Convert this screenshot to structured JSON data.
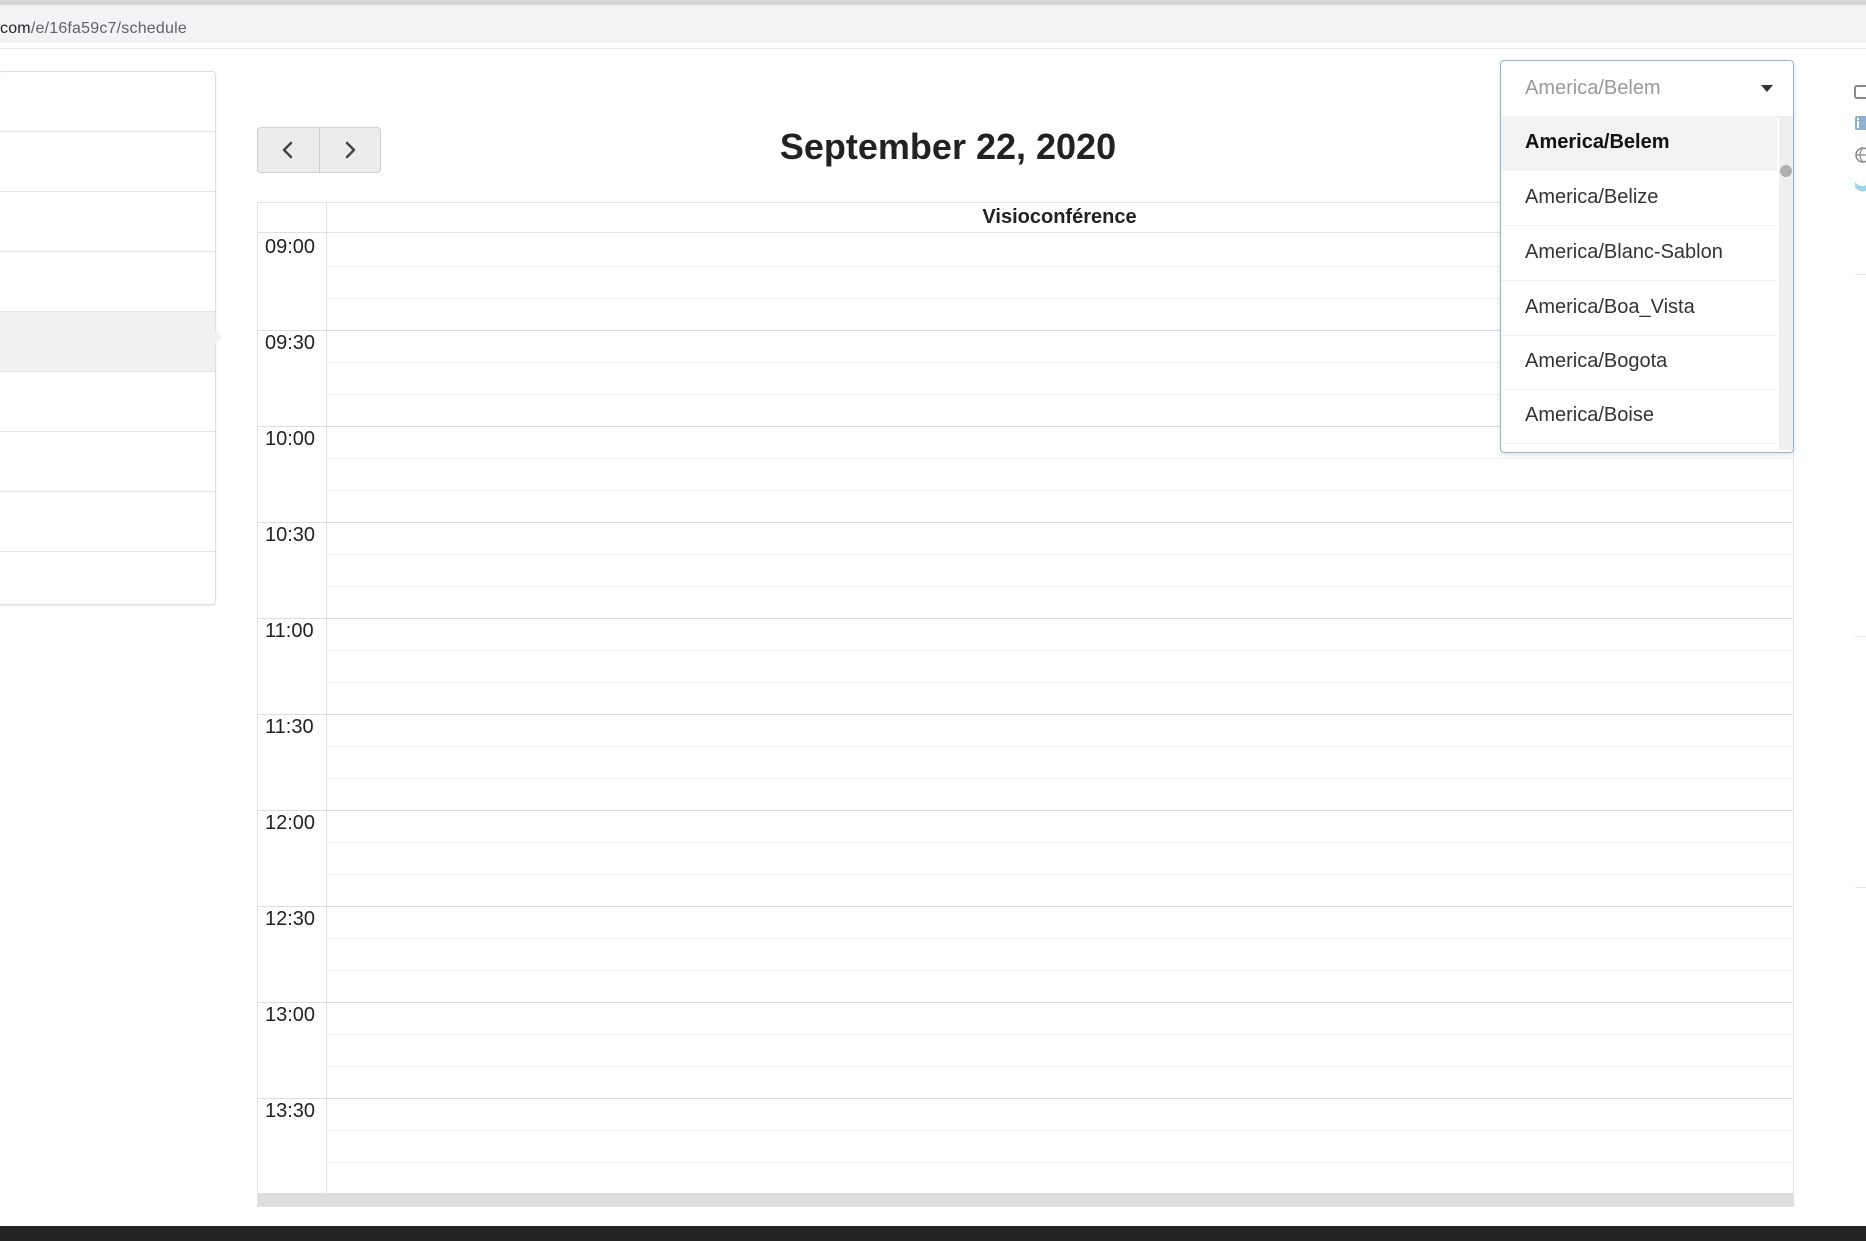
{
  "browser": {
    "url_host": "com",
    "url_path": "/e/16fa59c7/schedule"
  },
  "calendar": {
    "date_title": "September 22, 2020",
    "column_title": "Visioconférence",
    "prev_icon": "chevron-left-icon",
    "next_icon": "chevron-right-icon",
    "time_labels": [
      "09:00",
      "09:30",
      "10:00",
      "10:30",
      "11:00",
      "11:30",
      "12:00",
      "12:30",
      "13:00",
      "13:30"
    ]
  },
  "timezone": {
    "selected": "America/Belem",
    "options": [
      "America/Belem",
      "America/Belize",
      "America/Blanc-Sablon",
      "America/Boa_Vista",
      "America/Bogota",
      "America/Boise"
    ]
  },
  "side_icons": [
    "camera-icon",
    "linkedin-icon",
    "globe-icon",
    "twitter-icon"
  ],
  "colors": {
    "linkedin": "#8fb0d0",
    "twitter": "#9fd3ea",
    "dropdown_border": "#8fb4d6"
  }
}
